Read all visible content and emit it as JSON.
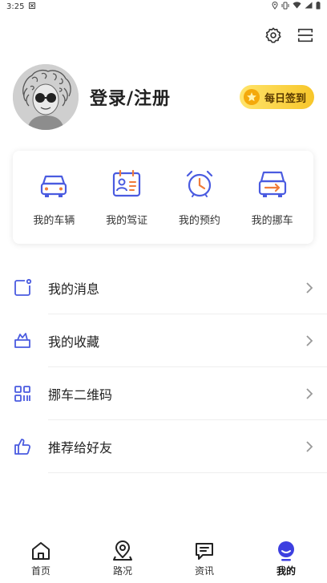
{
  "status_bar": {
    "time": "3:25",
    "icons": [
      "notification-icon",
      "location-icon",
      "vibrate-icon",
      "wifi-icon",
      "signal-icon",
      "battery-icon"
    ]
  },
  "top_actions": {
    "icons": [
      "gear-icon",
      "scan-icon"
    ]
  },
  "profile": {
    "login_text": "登录/注册",
    "signin_label": "每日签到"
  },
  "quick": {
    "items": [
      {
        "label": "我的车辆",
        "icon": "car-icon"
      },
      {
        "label": "我的驾证",
        "icon": "license-icon"
      },
      {
        "label": "我的预约",
        "icon": "alarm-clock-icon"
      },
      {
        "label": "我的挪车",
        "icon": "move-car-icon"
      }
    ]
  },
  "menu": {
    "items": [
      {
        "label": "我的消息",
        "icon": "message-icon"
      },
      {
        "label": "我的收藏",
        "icon": "favorite-icon"
      },
      {
        "label": "挪车二维码",
        "icon": "qrcode-icon"
      },
      {
        "label": "推荐给好友",
        "icon": "thumbs-up-icon"
      }
    ]
  },
  "nav": {
    "items": [
      {
        "label": "首页",
        "icon": "home-icon"
      },
      {
        "label": "路况",
        "icon": "map-pin-icon"
      },
      {
        "label": "资讯",
        "icon": "chat-icon"
      },
      {
        "label": "我的",
        "icon": "profile-icon"
      }
    ],
    "active_index": 3
  },
  "colors": {
    "accent_blue": "#4a5be0",
    "accent_orange": "#f07c3a",
    "signin_gold": "#f7c62a",
    "nav_active": "#3d3fe0"
  }
}
